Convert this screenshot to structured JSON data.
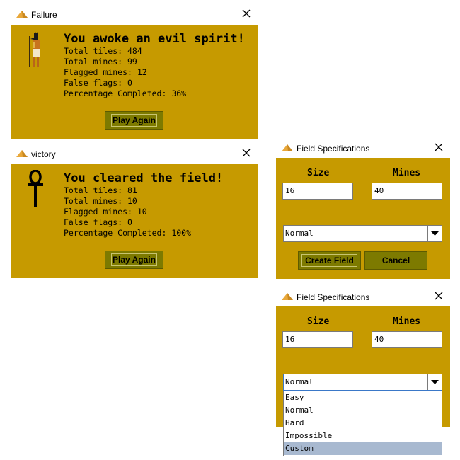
{
  "failure_dialog": {
    "title": "Failure",
    "headline": "You awoke an evil spirit!",
    "stats": [
      "Total tiles: 484",
      "Total mines: 99",
      "Flagged mines: 12",
      "False flags: 0",
      "Percentage Completed: 36%"
    ],
    "button": "Play Again",
    "icon": "anubis-icon"
  },
  "victory_dialog": {
    "title": "victory",
    "headline": "You cleared the field!",
    "stats": [
      "Total tiles: 81",
      "Total mines: 10",
      "Flagged mines: 10",
      "False flags: 0",
      "Percentage Completed: 100%"
    ],
    "button": "Play Again",
    "icon": "ankh-icon"
  },
  "field_spec_1": {
    "title": "Field Specifications",
    "size_label": "Size",
    "mines_label": "Mines",
    "size_value": "16",
    "mines_value": "40",
    "difficulty": "Normal",
    "create_button": "Create Field",
    "cancel_button": "Cancel"
  },
  "field_spec_2": {
    "title": "Field Specifications",
    "size_label": "Size",
    "mines_label": "Mines",
    "size_value": "16",
    "mines_value": "40",
    "difficulty": "Normal",
    "options": [
      "Easy",
      "Normal",
      "Hard",
      "Impossible",
      "Custom"
    ],
    "highlighted_option": "Custom"
  },
  "colors": {
    "panel": "#c69a00",
    "button": "#7d7a00",
    "highlight": "#a8b9d0"
  }
}
